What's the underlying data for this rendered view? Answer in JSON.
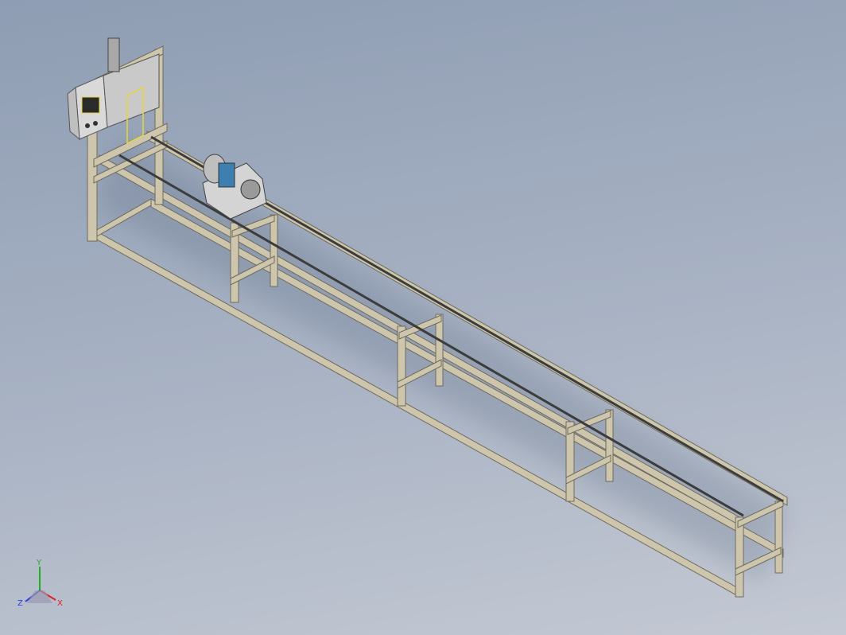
{
  "triad": {
    "x_label": "X",
    "y_label": "Y",
    "z_label": "Z",
    "colors": {
      "x": "#e02020",
      "y": "#1fb21f",
      "z": "#2a3be0"
    }
  },
  "model": {
    "frame_color": "#cdc6ac",
    "frame_edge": "#6e6a5c",
    "rail_color": "#3c3c3c",
    "panel_color": "#d9d9d9",
    "accent_yellow": "#e8d63a",
    "accent_blue": "#3d7fb0"
  }
}
